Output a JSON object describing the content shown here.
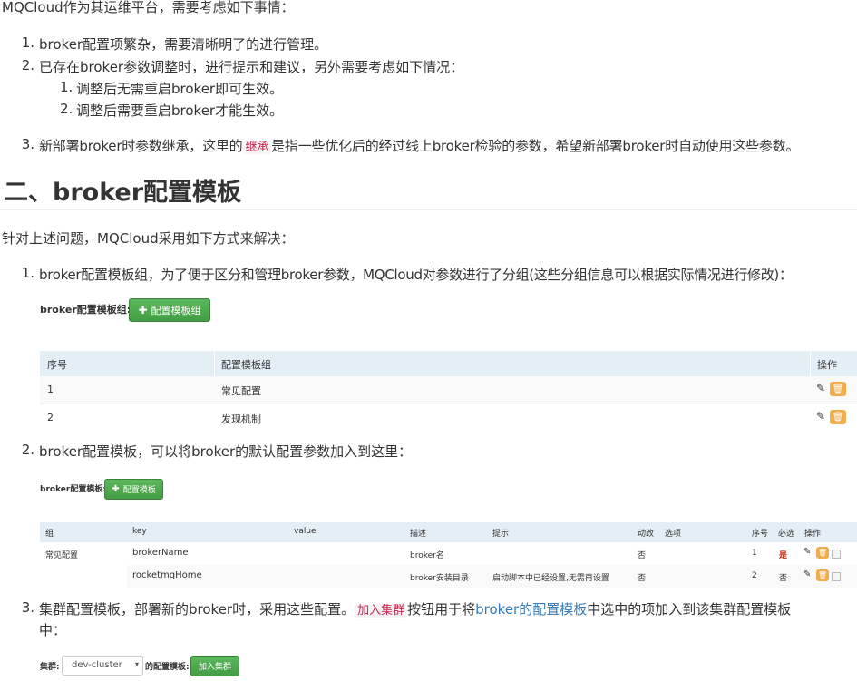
{
  "intro": "MQCloud作为其运维平台，需要考虑如下事情：",
  "list1": {
    "item1": {
      "num": "1.",
      "text": "broker配置项繁杂，需要清晰明了的进行管理。"
    },
    "item2": {
      "num": "2.",
      "text": "已存在broker参数调整时，进行提示和建议，另外需要考虑如下情况：",
      "sub1": {
        "num": "1.",
        "text": "调整后无需重启broker即可生效。"
      },
      "sub2": {
        "num": "2.",
        "text": "调整后需要重启broker才能生效。"
      }
    },
    "item3": {
      "num": "3.",
      "text_before": "新部署broker时参数继承，这里的",
      "code": "继承",
      "text_after": "是指一些优化后的经过线上broker检验的参数，希望新部署broker时自动使用这些参数。"
    }
  },
  "section_title": "二、broker配置模板",
  "section_intro": "针对上述问题，MQCloud采用如下方式来解决：",
  "list2": {
    "item1": {
      "num": "1.",
      "text": "broker配置模板组，为了便于区分和管理broker参数，MQCloud对参数进行了分组(这些分组信息可以根据实际情况进行修改)："
    },
    "item2": {
      "num": "2.",
      "text": "broker配置模板，可以将broker的默认配置参数加入到这里："
    },
    "item3": {
      "num": "3.",
      "text_a": "集群配置模板，部署新的broker时，采用这些配置。",
      "code": "加入集群",
      "text_b": "按钮用于将",
      "link": "broker的配置模板",
      "text_c": "中选中的项加入到该集群配置模板",
      "line2": "中："
    }
  },
  "shot1": {
    "label": "broker配置模板组:",
    "button": "配置模板组",
    "headers": [
      "序号",
      "配置模板组",
      "操作"
    ],
    "rows": [
      {
        "id": "1",
        "name": "常见配置"
      },
      {
        "id": "2",
        "name": "发现机制"
      }
    ]
  },
  "shot2": {
    "label": "broker配置模板:",
    "button": "配置模板",
    "headers": [
      "组",
      "key",
      "value",
      "描述",
      "提示",
      "动改",
      "选项",
      "序号",
      "必选",
      "操作"
    ],
    "rows": [
      {
        "group": "常见配置",
        "key": "brokerName",
        "value": "",
        "desc": "broker名",
        "hint": "",
        "dyn": "否",
        "opt": "",
        "seq": "1",
        "req": "是"
      },
      {
        "group": "",
        "key": "rocketmqHome",
        "value": "",
        "desc": "broker安装目录",
        "hint": "启动脚本中已经设置,无需再设置",
        "dyn": "否",
        "opt": "",
        "seq": "2",
        "req": "否"
      }
    ]
  },
  "shot3": {
    "label_cluster": "集群:",
    "select_value": "dev-cluster",
    "label_tpl": "的配置模板:",
    "button": "加入集群"
  },
  "colors": {
    "code_bg": "#f9f2f4",
    "code_fg": "#c7254e",
    "link": "#337ab7",
    "green": "#5cb85c",
    "orange": "#f0ad4e",
    "header_bg": "#e4eff5",
    "required": "#d9230f"
  },
  "icons": [
    "plus-icon",
    "pencil-icon",
    "trash-icon",
    "checkbox-icon",
    "caret-down-icon"
  ]
}
